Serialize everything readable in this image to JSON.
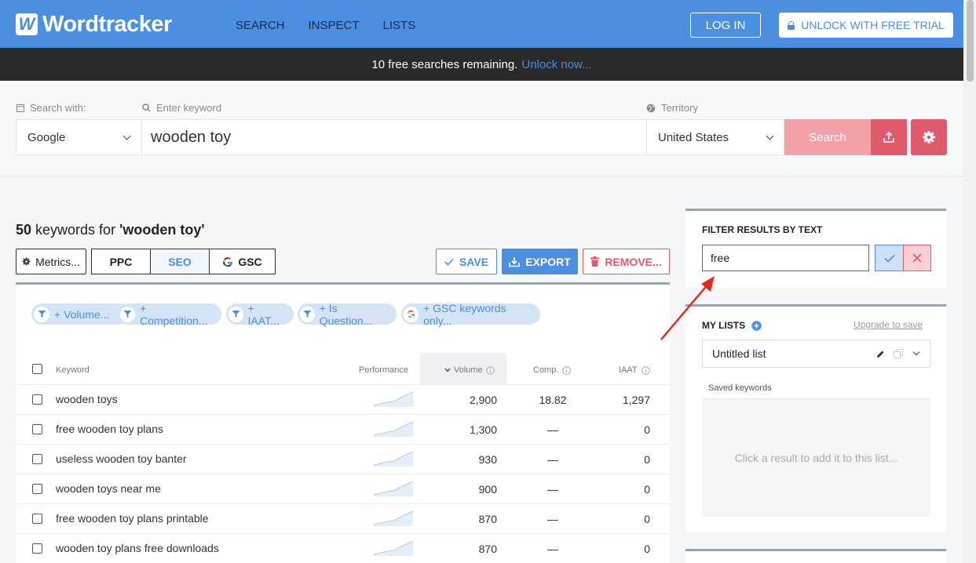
{
  "header": {
    "logo_mark": "W",
    "logo_text": "Wordtracker",
    "nav": [
      "SEARCH",
      "INSPECT",
      "LISTS"
    ],
    "login_label": "LOG IN",
    "unlock_label": "UNLOCK WITH FREE TRIAL"
  },
  "notice": {
    "text": "10 free searches remaining.",
    "link": "Unlock now..."
  },
  "search": {
    "search_with_label": "Search with:",
    "keyword_label": "Enter keyword",
    "territory_label": "Territory",
    "engine": "Google",
    "keyword": "wooden toy",
    "territory": "United States",
    "search_label": "Search"
  },
  "results": {
    "count": "50",
    "title_middle": " keywords for ",
    "query": "'wooden toy'",
    "metrics_label": "Metrics...",
    "tabs": [
      "PPC",
      "SEO",
      "GSC"
    ],
    "active_tab": "SEO",
    "save_label": "SAVE",
    "export_label": "EXPORT",
    "remove_label": "REMOVE...",
    "filters": [
      "+ Volume...",
      "+ Competition...",
      "+ IAAT...",
      "+ Is Question...",
      "+ GSC keywords only..."
    ],
    "columns": {
      "keyword": "Keyword",
      "performance": "Performance",
      "volume": "Volume",
      "comp": "Comp.",
      "iaat": "IAAT"
    },
    "rows": [
      {
        "keyword": "wooden toys",
        "volume": "2,900",
        "comp": "18.82",
        "iaat": "1,297"
      },
      {
        "keyword": "free wooden toy plans",
        "volume": "1,300",
        "comp": "—",
        "iaat": "0"
      },
      {
        "keyword": "useless wooden toy banter",
        "volume": "930",
        "comp": "—",
        "iaat": "0"
      },
      {
        "keyword": "wooden toys near me",
        "volume": "900",
        "comp": "—",
        "iaat": "0"
      },
      {
        "keyword": "free wooden toy plans printable",
        "volume": "870",
        "comp": "—",
        "iaat": "0"
      },
      {
        "keyword": "wooden toy plans free downloads",
        "volume": "870",
        "comp": "—",
        "iaat": "0"
      }
    ]
  },
  "filter_panel": {
    "title": "FILTER RESULTS BY TEXT",
    "value": "free"
  },
  "lists_panel": {
    "title": "MY LISTS",
    "upgrade_link": "Upgrade to save",
    "list_name": "Untitled list",
    "saved_label": "Saved keywords",
    "empty_text": "Click a result to add it to this list..."
  },
  "colors": {
    "brand_blue": "#4a8fe0",
    "accent_red": "#e05a6d",
    "dark_bar": "#2a2a2a"
  }
}
